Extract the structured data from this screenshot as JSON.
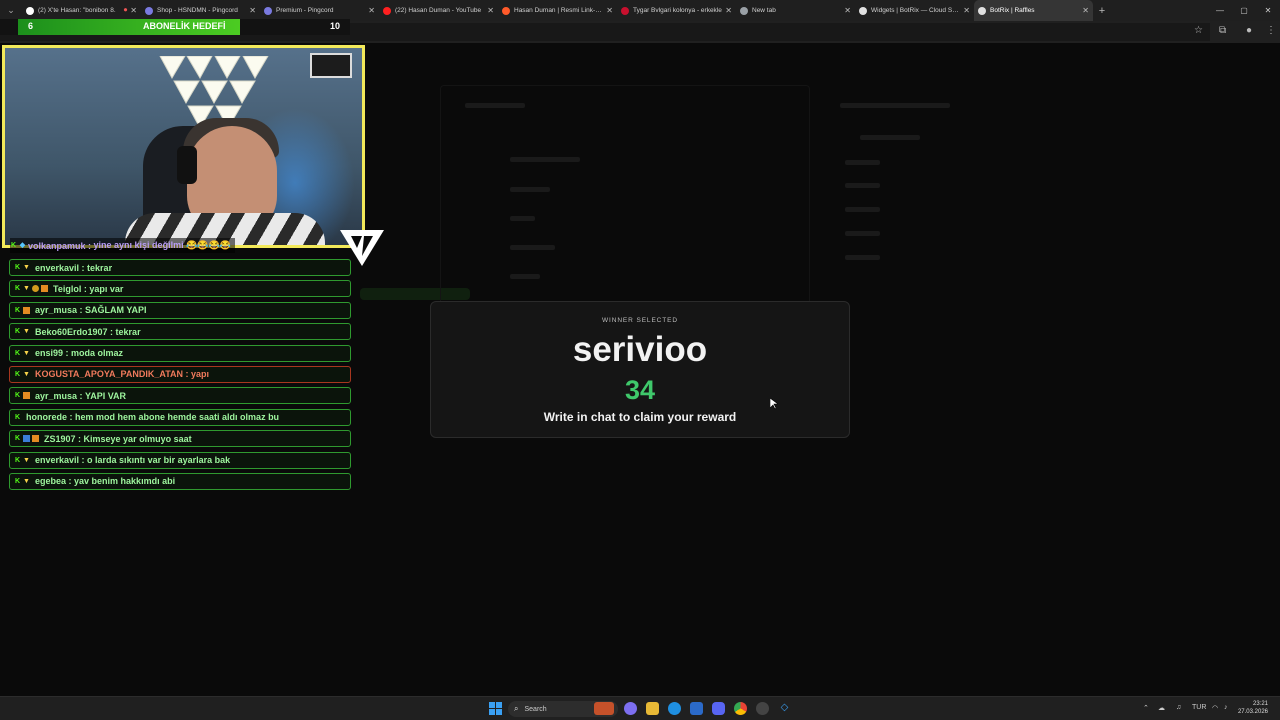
{
  "browser": {
    "tabs": [
      {
        "title": "(2) X'te Hasan: \"bonibon 8.",
        "color": "#000000",
        "fav_color": "#ffffff",
        "extra": "⏺"
      },
      {
        "title": "Shop - HSNDMN - Pingcord",
        "fav_color": "#7a7ae0"
      },
      {
        "title": "Premium - Pingcord",
        "fav_color": "#7a7ae0"
      },
      {
        "title": "(22) Hasan Duman - YouTube",
        "fav_color": "#ff2020"
      },
      {
        "title": "Hasan Duman | Resmi Link-In-B",
        "fav_color": "#ff5a2a"
      },
      {
        "title": "Tygar Bvlgari kolonya - erkekle",
        "fav_color": "#c8102e"
      },
      {
        "title": "New tab",
        "fav_color": "#9aa0a6"
      },
      {
        "title": "Widgets | BotRix — Cloud Strea",
        "fav_color": "#e0e0e0"
      },
      {
        "title": "BotRix | Raffles",
        "fav_color": "#e0e0e0",
        "active": true
      }
    ],
    "new_tab_glyph": "+",
    "window_controls": [
      "—",
      "▢",
      "✕"
    ],
    "close_glyph": "✕"
  },
  "goal": {
    "left_value": "6",
    "title": "ABONELİK HEDEFİ",
    "right_value": "10",
    "progress": 0.6
  },
  "chat": {
    "first": {
      "user": "volkanpamuk",
      "text": "yine aynı kişi değilmi 😂😂😂😂"
    },
    "messages": [
      {
        "user": "enverkavil",
        "text": "tekrar",
        "badges": [
          "k",
          "v"
        ],
        "style": "green"
      },
      {
        "user": "Teiglol",
        "text": "yapı var",
        "badges": [
          "k",
          "v",
          "o",
          "c"
        ],
        "style": "green"
      },
      {
        "user": "ayr_musa",
        "text": "SAĞLAM YAPI",
        "badges": [
          "k",
          "c"
        ],
        "style": "green"
      },
      {
        "user": "Beko60Erdo1907",
        "text": "tekrar",
        "badges": [
          "k",
          "v"
        ],
        "style": "green"
      },
      {
        "user": "ensi99",
        "text": "moda olmaz",
        "badges": [
          "k",
          "v"
        ],
        "style": "green"
      },
      {
        "user": "KOGUSTA_APOYA_PANDIK_ATAN",
        "text": "yapı",
        "badges": [
          "k",
          "v"
        ],
        "style": "orange"
      },
      {
        "user": "ayr_musa",
        "text": "YAPI VAR",
        "badges": [
          "k",
          "c"
        ],
        "style": "green"
      },
      {
        "user": "honorede",
        "text": "hem mod hem abone hemde saati aldı olmaz bu",
        "badges": [
          "k"
        ],
        "style": "green"
      },
      {
        "user": "ZS1907",
        "text": "Kimseye yar olmuyo saat",
        "badges": [
          "k",
          "s",
          "c"
        ],
        "style": "green"
      },
      {
        "user": "enverkavil",
        "text": "o larda sıkıntı var bir ayarlara bak",
        "badges": [
          "k",
          "v"
        ],
        "style": "green"
      },
      {
        "user": "egebea",
        "text": "yav benim hakkımdı abi",
        "badges": [
          "k",
          "v"
        ],
        "style": "green"
      }
    ]
  },
  "winner": {
    "label": "WINNER SELECTED",
    "name": "serivioo",
    "number": "34",
    "hint": "Write in chat to claim your reward"
  },
  "taskbar": {
    "search_placeholder": "Search",
    "tray_lang": "TUR",
    "time": "23:21",
    "date": "27.03.2026"
  }
}
